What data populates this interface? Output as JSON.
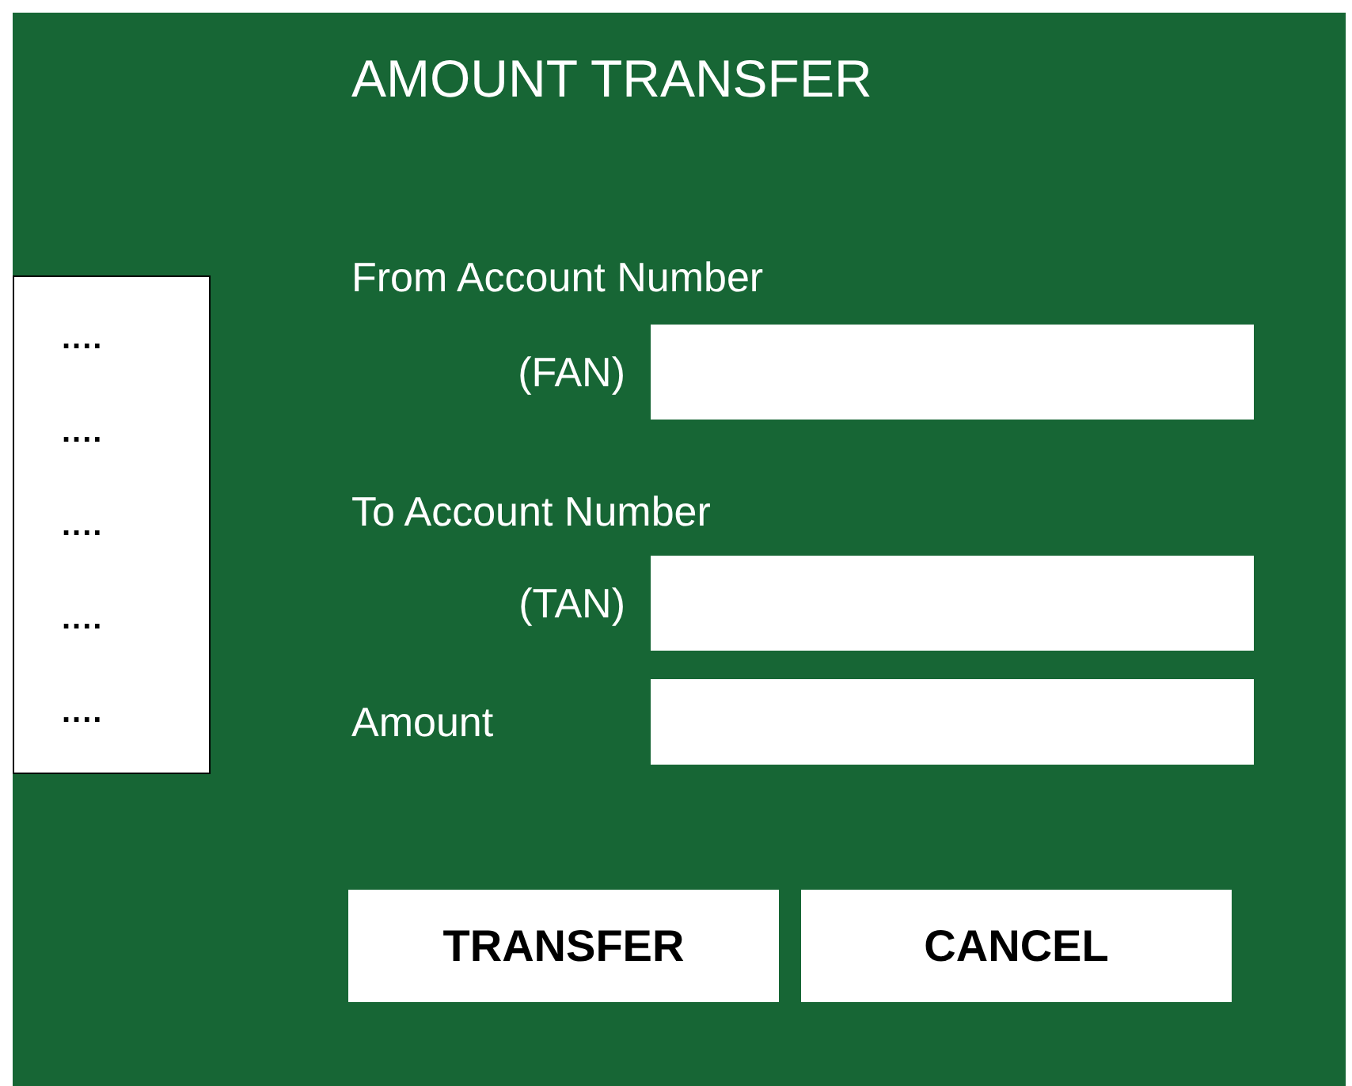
{
  "title": "AMOUNT TRANSFER",
  "sidebar": {
    "items": [
      "....",
      "....",
      "....",
      "....",
      "...."
    ]
  },
  "fields": [
    {
      "label": "From Account Number",
      "sublabel": "(FAN)"
    },
    {
      "label": "To Account Number",
      "sublabel": "(TAN)"
    },
    {
      "label": "Amount"
    }
  ],
  "buttons": [
    "TRANSFER",
    "CANCEL"
  ]
}
